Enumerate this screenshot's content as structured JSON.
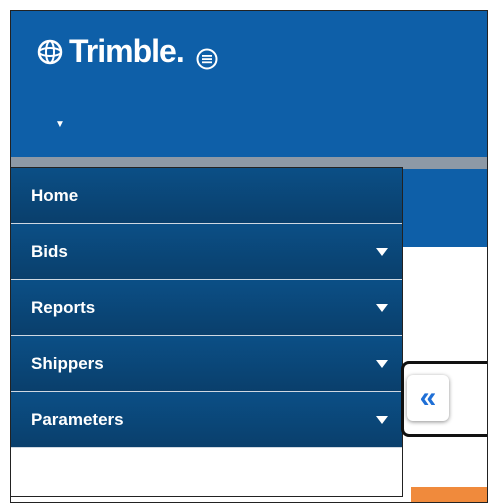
{
  "brand": {
    "name": "Trimble.",
    "logo_icon": "trimble-globe-icon",
    "menu_icon": "menu-icon"
  },
  "header": {
    "user_caret": "▼"
  },
  "nav": {
    "items": [
      {
        "label": "Home",
        "has_caret": false
      },
      {
        "label": "Bids",
        "has_caret": true
      },
      {
        "label": "Reports",
        "has_caret": true
      },
      {
        "label": "Shippers",
        "has_caret": true
      },
      {
        "label": "Parameters",
        "has_caret": true
      }
    ]
  },
  "collapse": {
    "glyph": "«",
    "icon": "chevrons-left-icon"
  },
  "colors": {
    "brand_blue": "#0e5fa8",
    "nav_blue": "#0b4f86",
    "accent_orange": "#f08a3c",
    "link_blue": "#1f6fd6"
  }
}
